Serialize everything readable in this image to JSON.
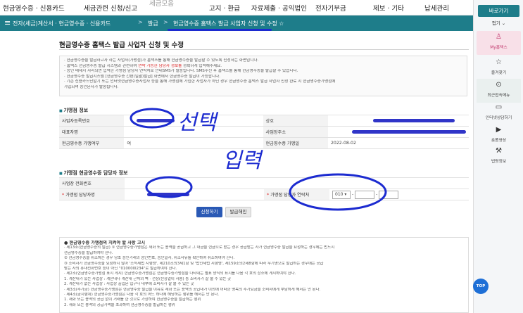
{
  "topnav": {
    "items": [
      "현금영수증 · 신용카드",
      "세금관련 신청/신고",
      "세금모음",
      "고지 · 환급",
      "자료제출 · 공익법인",
      "전자기부금",
      "제보 · 기타",
      "납세관리"
    ]
  },
  "breadcrumb": {
    "menu_icon": "≡",
    "c1": "전자(세금)계산서 · 현금영수증 · 신용카드",
    "c2": "발급",
    "c3": "현금영수증 홈택스 발급 사업자 신청 및 수정 ☆",
    "sep": ">"
  },
  "page": {
    "title": "현금영수증 홈택스 발급 사업자 신청 및 수정"
  },
  "notice": [
    "· 현금영수증을 발급하고자 하는 사업자(가맹점)가 홈택스를 통해 현금영수증을 발급할 수 있도록 신청하는 화면입니다.",
    "  - 홈택스 현금영수증 발급 시스템과 관련하여 연락 가능한 담당자 정보를 정확하게 입력해주세요.",
    "  - 승인 메세지 자리되면 입력한 가맹점 담당자 연락처로 안내SMS가 발송됩니다. SMS수신 후 홈택스를 통해 현금영수증을 발급할 수 있습니다.",
    "· 현금영수증 발급시스템 [현금영수증 간편(일괄)발급] 화면에서 현금영수증 발급이 가능합니다.",
    "· 기존 신용카드단말기 또는 인터넷현금영수증사업자 등을 통해 가맹점에 가입한 사업자가 아닌 경우 현금영수증 홈택스 발급 사업자 신청 완료 시 현금영수증가맹점에",
    "  가입되며 승인문자가 발송됩니다."
  ],
  "notice_red": "연락 가능한 담당자 정보를",
  "sec1": {
    "title": "가맹점 정보",
    "rows": [
      {
        "l1": "사업자등록번호",
        "v1": "",
        "l2": "상호",
        "v2": ""
      },
      {
        "l1": "대표자명",
        "v1": "",
        "l2": "사업장주소",
        "v2": ""
      },
      {
        "l1": "현금영수증 가맹여부",
        "v1": "여",
        "l2": "현금영수증 가맹일",
        "v2": "2022-08-02"
      }
    ]
  },
  "sec2": {
    "title": "가맹점 현금영수증 담당자 정보",
    "row1_label": "사업장 전화번호",
    "row2_label1": "가맹점 담당자명",
    "row2_label2": "가맹점 담당자 연락처",
    "required_mark": "*",
    "phone_prefix": "010",
    "dash": "-"
  },
  "buttons": {
    "apply": "신청하기",
    "cancel": "발급해인"
  },
  "guide": [
    "● 현금영수증 가맹점의 지켜야 할 사항 고시",
    "· 제13조(현금영수증의 발급) ① 현금영수증가맹점은 재화 또는 용역을 공급하고 그 대금을 현금으로 받는 경우 공급받는 자가 현금영수증 발급을 요청하는 경우에는 반드시",
    "  현금영수증을 발급하여야 한다.",
    "  ② 현금영수증을 취소하는 경우 당초 승인거래의 승인번호, 승인일자, 취소사유를 확인하여 취소하여야 한다.",
    "  ③ 소비자가 현금영수증을 요청하지 않아 '소득세법 시행령', 제210조의3제1항 및 '법인세법 시행령', 제159조의2제8항에 따라 무기명으로 발급하는 경우에는 공급",
    "  받는 자의 휴대전화번호 등이 아닌 \"010000I234\"로 발급하여야 한다.",
    "· 제2조(현금영수증가맹점 표지 게시) 현금영수증가맹점은 현금영수증가맹점을 나타내는 별표 양식의 표지를 다음 각 호의 장소에 게시하여야 한다.",
    "  1. 계산대가 있는 사업장 : 계산대나 계산대 근처의 벽 · 천장(천장걸이 사용) 등 소비자가 잘 볼 수 있는 곳",
    "  2. 계산대가 없는 사업장 : 사업장 출입문 입구나 내부에 소비자가 잘 볼 수 있는 곳",
    "· 제3조(추가금) 현금영수증가맹점은 현금영수증 발급을 이유로 재화 또는 용역의 공급대가 이외에 어떠한 명목의 추가요금을 소비자에게 부담하게 해서는 안 된다.",
    "· 제4조(금지행위) 현금영수증가맹점은 다음 각 호의 어느 하나에 해당하는 행위를 해서는 안 된다.",
    "  1. 재화 또는 용역의 공급 없이 거래를 한 것으로 가장하여 현금영수증을 발급하는 행위",
    "  2. 재화 또는 용역의 공급가액을 초과하여 현금영수증을 발급하는 행위"
  ],
  "annotations": {
    "select": "선택",
    "input": "입력"
  },
  "sidebar": {
    "header": "바로가기",
    "fold": "접기 ⌄",
    "items": [
      {
        "label": "My홈택스",
        "icon": "person-icon"
      },
      {
        "label": "즐겨찾기",
        "icon": "star-icon"
      },
      {
        "label": "최근접속메뉴",
        "icon": "clock-icon"
      },
      {
        "label": "인터넷상담하기",
        "icon": "monitor-icon"
      },
      {
        "label": "숏폼영상",
        "icon": "play-icon"
      },
      {
        "label": "법령정보",
        "icon": "gavel-icon"
      }
    ],
    "top": "TOP"
  },
  "colors": {
    "teal": "#1e7d8a",
    "pen_blue": "#1c2bd0",
    "button_blue": "#2a59b5"
  }
}
